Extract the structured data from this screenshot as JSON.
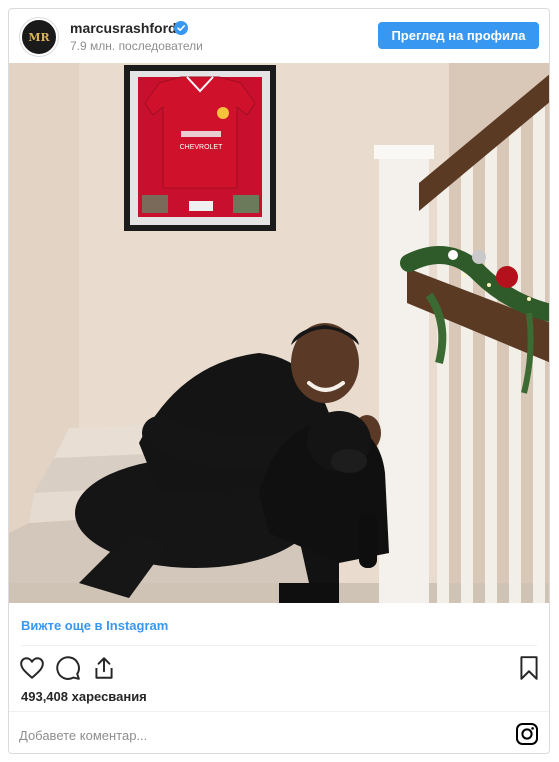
{
  "header": {
    "username": "marcusrashford",
    "followers": "7.9 млн. последователи",
    "profile_button": "Преглед на профила",
    "avatar_letters": "MR"
  },
  "photo": {
    "jersey_sponsor": "CHEVROLET"
  },
  "footer": {
    "more_link": "Вижте още в Instagram",
    "likes": "493,408 харесвания",
    "comment_placeholder": "Добавете коментар..."
  },
  "colors": {
    "accent": "#3897f0",
    "text": "#262626",
    "muted": "#8e8e8e",
    "border": "#dbdbdb",
    "verified": "#3897f0"
  },
  "icons": [
    "verified-badge-icon",
    "heart-icon",
    "comment-icon",
    "share-icon",
    "bookmark-icon",
    "instagram-icon"
  ]
}
